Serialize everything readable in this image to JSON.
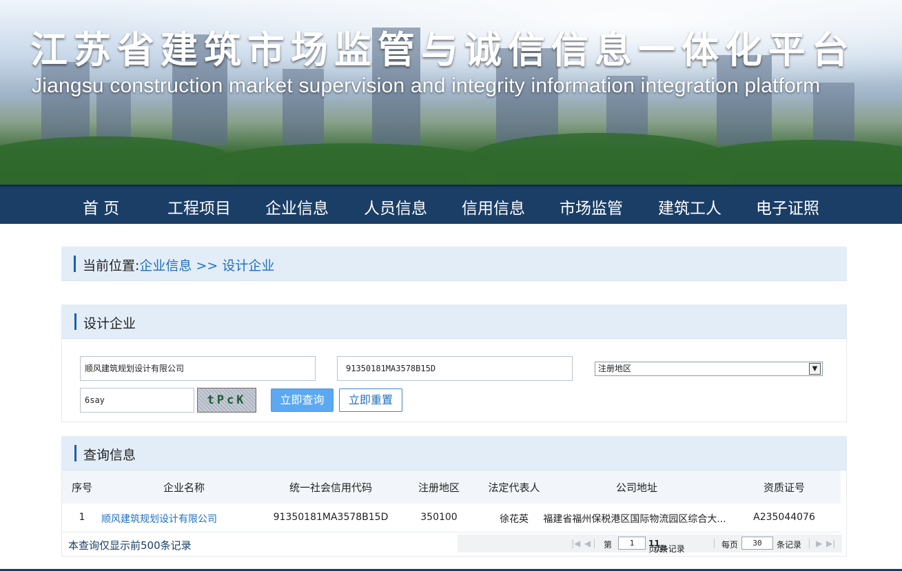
{
  "banner": {
    "title": "江苏省建筑市场监管与诚信信息一体化平台",
    "subtitle": "Jiangsu construction market supervision and integrity information integration platform"
  },
  "nav": {
    "items": [
      "首 页",
      "工程项目",
      "企业信息",
      "人员信息",
      "信用信息",
      "市场监管",
      "建筑工人",
      "电子证照"
    ]
  },
  "breadcrumb": {
    "label": "当前位置:",
    "level1": "企业信息",
    "separator": " >> ",
    "level2": "设计企业"
  },
  "search": {
    "title": "设计企业",
    "company_name_value": "顺风建筑规划设计有限公司",
    "credit_code_value": "91350181MA3578B15D",
    "region_selected": "注册地区",
    "captcha_input_value": "6say",
    "captcha_image_text": "tPcK",
    "query_button": "立即查询",
    "reset_button": "立即重置"
  },
  "results": {
    "title": "查询信息",
    "columns": [
      "序号",
      "企业名称",
      "统一社会信用代码",
      "注册地区",
      "法定代表人",
      "公司地址",
      "资质证号"
    ],
    "rows": [
      {
        "index": "1",
        "name": "顺风建筑规划设计有限公司",
        "credit_code": "91350181MA3578B15D",
        "region": "350100",
        "legal_rep": "徐花英",
        "address": "福建省福州保税港区国际物流园区综合大...",
        "cert_no": "A235044076"
      }
    ],
    "note": "本查询仅显示前500条记录"
  },
  "pager": {
    "page_prefix": "第",
    "current_page": "1",
    "page_suffix_a": "页/共",
    "total_pages": "1",
    "page_suffix_b": "页",
    "total_records": "1",
    "records_suffix": "条记录",
    "per_page_label": "每页",
    "per_page": "30",
    "per_page_suffix": "条记录"
  },
  "colors": {
    "nav_bg": "#1b3e66",
    "panel_head_bg": "#e2edf8",
    "link": "#1f6fbf",
    "primary_button": "#5aa9f2"
  }
}
